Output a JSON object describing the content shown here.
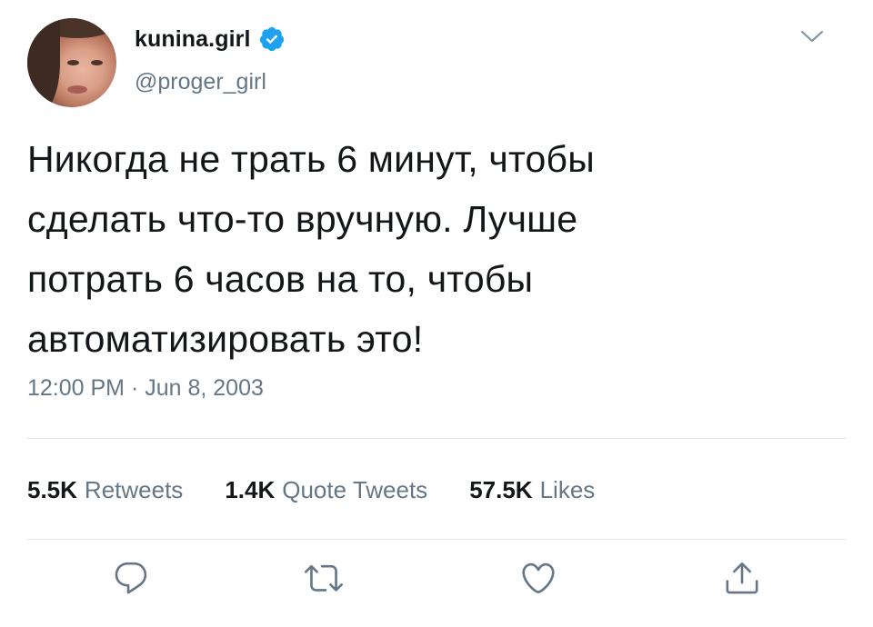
{
  "user": {
    "display_name": "kunina.girl",
    "handle": "@proger_girl",
    "verified": true
  },
  "tweet": {
    "lines": [
      "Никогда не трать 6 минут, чтобы",
      "сделать что-то вручную. Лучше",
      "потрать 6 часов на то, чтобы",
      "автоматизировать это!"
    ],
    "timestamp": "12:00 PM · Jun 8, 2003"
  },
  "stats": {
    "retweets_count": "5.5K",
    "retweets_label": "Retweets",
    "quote_count": "1.4K",
    "quote_label": "Quote Tweets",
    "likes_count": "57.5K",
    "likes_label": "Likes"
  },
  "icons": {
    "verified": "verified-badge-icon",
    "menu": "chevron-down-icon",
    "reply": "reply-icon",
    "retweet": "retweet-icon",
    "like": "heart-icon",
    "share": "share-icon"
  },
  "colors": {
    "accent": "#1da1f2",
    "text": "#14171a",
    "secondary": "#657786",
    "divider": "#e1e8ed"
  }
}
